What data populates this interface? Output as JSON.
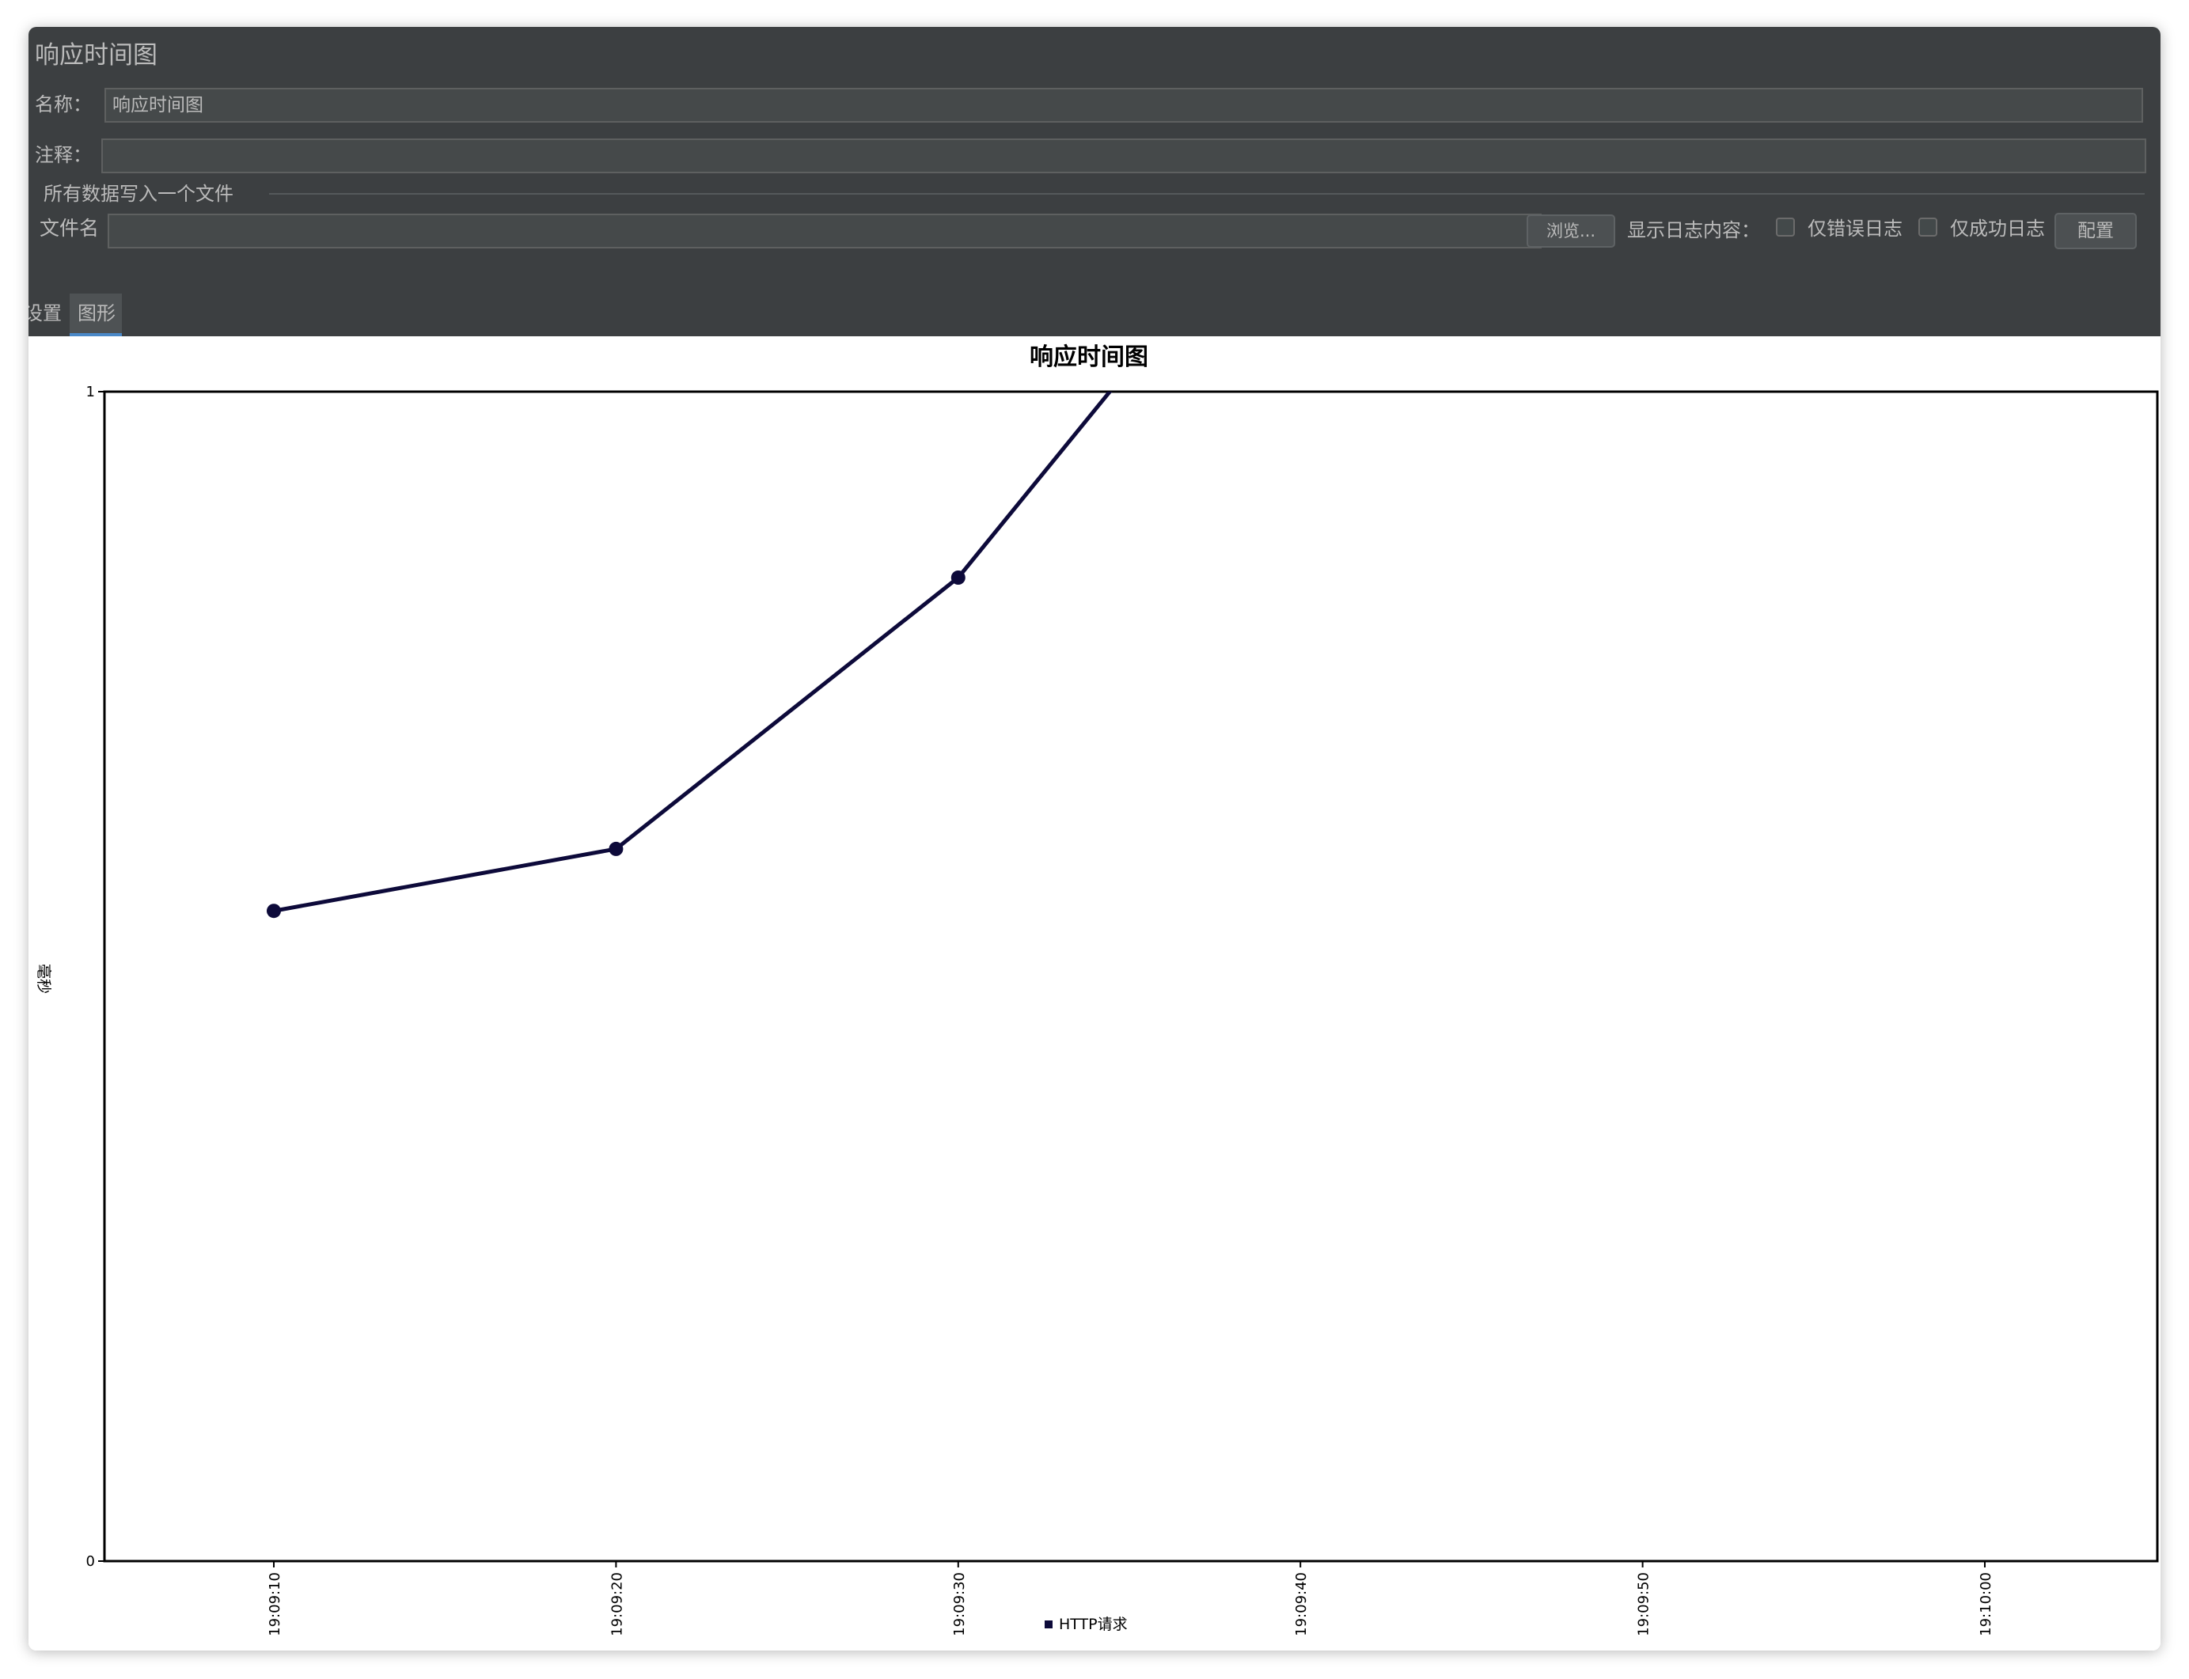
{
  "panel": {
    "title": "响应时间图",
    "name_label": "名称：",
    "name_value": "响应时间图",
    "comment_label": "注释：",
    "comment_value": "",
    "file_group_label": "所有数据写入一个文件",
    "filename_label": "文件名",
    "filename_value": "",
    "browse_label": "浏览...",
    "log_display_label": "显示日志内容：",
    "errors_only_label": "仅错误日志",
    "success_only_label": "仅成功日志",
    "configure_label": "配置"
  },
  "tabs": [
    {
      "label": "设置",
      "selected": false
    },
    {
      "label": "图形",
      "selected": true
    }
  ],
  "colors": {
    "panel_bg": "#3c3f41",
    "series": "#0d0a3a",
    "tab_accent": "#4a88c7"
  },
  "chart_data": {
    "type": "line",
    "title": "响应时间图",
    "xlabel": "",
    "ylabel": "毫秒",
    "ylim": [
      0,
      1
    ],
    "yticks": [
      "0",
      "1"
    ],
    "x_ticks": [
      "19:09:10",
      "19:09:20",
      "19:09:30",
      "19:09:40",
      "19:09:50",
      "19:10:00"
    ],
    "series": [
      {
        "name": "HTTP请求",
        "points": [
          {
            "x": "19:09:10",
            "y": 0.556
          },
          {
            "x": "19:09:20",
            "y": 0.609
          },
          {
            "x": "19:09:30",
            "y": 0.841
          },
          {
            "x": "19:09:40",
            "y": 1.2
          }
        ]
      }
    ],
    "legend": "bottom"
  }
}
